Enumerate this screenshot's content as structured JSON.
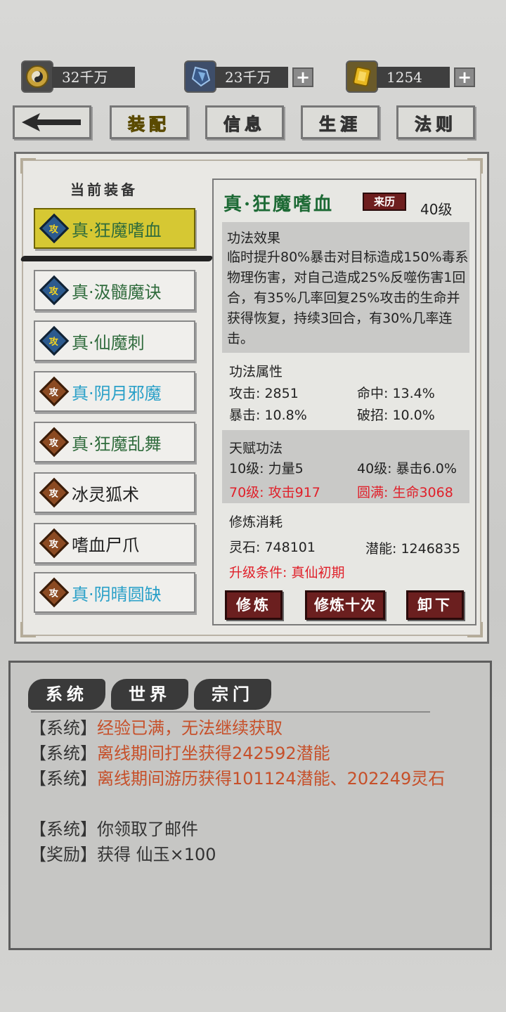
{
  "resources": [
    {
      "icon": "taiji-icon",
      "value": "32千万",
      "plus": false
    },
    {
      "icon": "spirit-crystal-icon",
      "value": "23千万",
      "plus": true
    },
    {
      "icon": "gold-ingot-icon",
      "value": "1254",
      "plus": true
    }
  ],
  "nav": {
    "back_icon": "arrow-left-icon",
    "tabs": [
      "装配",
      "信息",
      "生涯",
      "法则"
    ],
    "active": "装配"
  },
  "equip_title": "当前装备",
  "equipment": [
    {
      "badge": "攻",
      "name": "真·狂魔嗜血",
      "badge_color": "blue",
      "name_color": "green",
      "selected": true
    },
    {
      "badge": "攻",
      "name": "真·汲髓魔诀",
      "badge_color": "blue",
      "name_color": "green",
      "selected": false
    },
    {
      "badge": "攻",
      "name": "真·仙魔刺",
      "badge_color": "blue",
      "name_color": "green",
      "selected": false
    },
    {
      "badge": "攻",
      "name": "真·阴月邪魔",
      "badge_color": "brown",
      "name_color": "cyan",
      "selected": false
    },
    {
      "badge": "攻",
      "name": "真·狂魔乱舞",
      "badge_color": "brown",
      "name_color": "green",
      "selected": false
    },
    {
      "badge": "攻",
      "name": "冰灵狐术",
      "badge_color": "brown",
      "name_color": "black",
      "selected": false
    },
    {
      "badge": "攻",
      "name": "嗜血尸爪",
      "badge_color": "brown",
      "name_color": "black",
      "selected": false
    },
    {
      "badge": "攻",
      "name": "真·阴晴圆缺",
      "badge_color": "brown",
      "name_color": "cyan",
      "selected": false
    }
  ],
  "detail": {
    "title": "真·狂魔嗜血",
    "origin_button": "来历",
    "level": "40级",
    "effect_header": "功法效果",
    "effect_text": "临时提升80%暴击对目标造成150%毒系物理伤害，对自己造成25%反噬伤害1回合，有35%几率回复25%攻击的生命并获得恢复，持续3回合，有30%几率连击。",
    "attr_header": "功法属性",
    "attrs": {
      "attack": "攻击: 2851",
      "hit": "命中: 13.4%",
      "crit": "暴击: 10.8%",
      "break": "破招: 10.0%"
    },
    "talent_header": "天赋功法",
    "talents": {
      "t1": "10级: 力量5",
      "t2": "40级: 暴击6.0%",
      "t3": "70级: 攻击917",
      "t4": "圆满: 生命3068"
    },
    "cost_header": "修炼消耗",
    "cost": {
      "stone": "灵石: 748101",
      "potential": "潜能: 1246835"
    },
    "upgrade_condition": "升级条件: 真仙初期",
    "buttons": {
      "train": "修炼",
      "train10": "修炼十次",
      "unequip": "卸下"
    }
  },
  "chat": {
    "tabs": [
      "系统",
      "世界",
      "宗门"
    ],
    "lines": [
      {
        "tag": "【系统】",
        "msg": "经验已满，无法继续获取",
        "highlight": true
      },
      {
        "tag": "【系统】",
        "msg": "离线期间打坐获得242592潜能",
        "highlight": true
      },
      {
        "tag": "【系统】",
        "msg": "离线期间游历获得101124潜能、202249灵石",
        "highlight": true
      },
      {
        "tag": "【系统】",
        "msg": "你领取了邮件",
        "highlight": false
      },
      {
        "tag": "【奖励】",
        "msg": "获得 仙玉×100",
        "highlight": false
      }
    ]
  },
  "colors": {
    "accent_gold": "#d6c833",
    "dark_red_button": "#6b1f1f",
    "green_name": "#2f6b3c",
    "cyan_name": "#2aa0c8",
    "red_text": "#e0202a",
    "chat_highlight": "#c6502a"
  }
}
